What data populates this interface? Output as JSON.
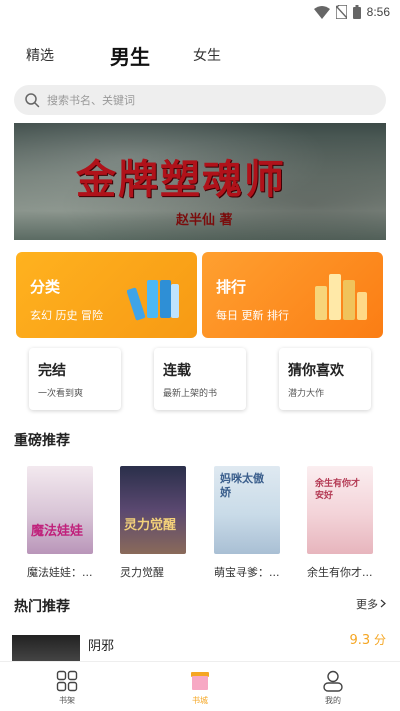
{
  "status_bar": {
    "time": "8:56"
  },
  "top_tabs": {
    "tab_left": "精选",
    "tab_active": "男生",
    "tab_right": "女生"
  },
  "search": {
    "placeholder": "搜索书名、关键词"
  },
  "banner": {
    "title": "金牌塑魂师",
    "author": "赵半仙 著"
  },
  "entry_cards": [
    {
      "title": "分类",
      "subtitle": "玄幻 历史 冒险"
    },
    {
      "title": "排行",
      "subtitle": "每日 更新 排行"
    }
  ],
  "small_cards": [
    {
      "title": "完结",
      "subtitle": "一次看到爽"
    },
    {
      "title": "连载",
      "subtitle": "最新上架的书"
    },
    {
      "title": "猜你喜欢",
      "subtitle": "潜力大作"
    }
  ],
  "featured": {
    "title": "重磅推荐",
    "books": [
      {
        "name": "魔法娃娃：...",
        "cover_text": "魔法娃娃"
      },
      {
        "name": "灵力觉醒",
        "cover_text": "灵力觉醒"
      },
      {
        "name": "萌宝寻爹：...",
        "cover_text": "妈咪太傲娇"
      },
      {
        "name": "余生有你才...",
        "cover_text": "余生有你才安好"
      }
    ]
  },
  "hot": {
    "title": "热门推荐",
    "more": "更多",
    "first_book": {
      "title": "阴邪",
      "score": "9.3",
      "score_unit": "分"
    }
  },
  "tabbar": {
    "items": [
      {
        "label": "书架"
      },
      {
        "label": "书城"
      },
      {
        "label": "我的"
      }
    ]
  },
  "colors": {
    "accent": "#f5a623",
    "orange_card": "#fb8c18",
    "yellow_card": "#ffad1c"
  }
}
